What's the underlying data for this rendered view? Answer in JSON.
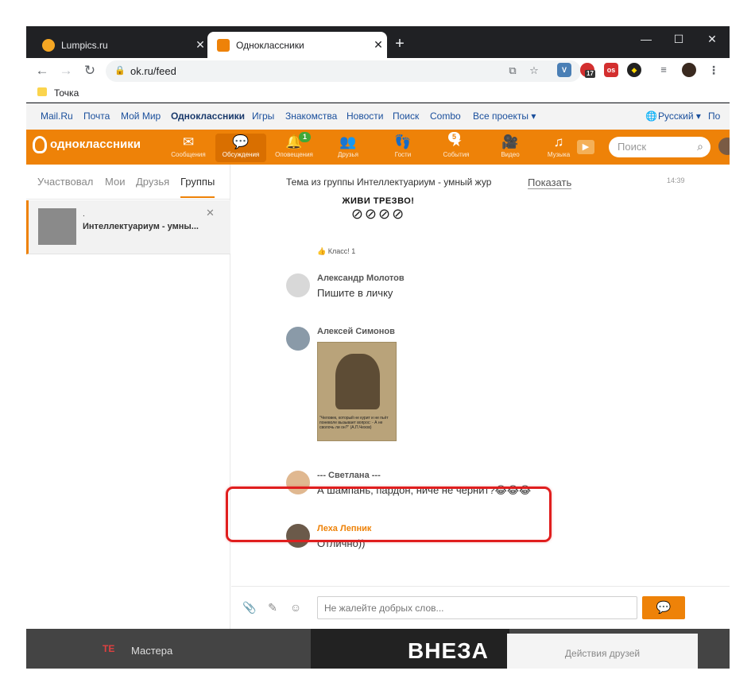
{
  "browser": {
    "tabs": [
      {
        "title": "Lumpics.ru",
        "favicon_color": "#f5a623",
        "active": false
      },
      {
        "title": "Одноклассники",
        "favicon_color": "#ee8208",
        "active": true
      }
    ],
    "url": "ok.ru/feed",
    "bookmark": "Точка",
    "ext_badge": "17"
  },
  "portal": {
    "links": [
      "Mail.Ru",
      "Почта",
      "Мой Мир",
      "Одноклассники",
      "Игры",
      "Знакомства",
      "Новости",
      "Поиск",
      "Combo",
      "Все проекты ▾"
    ],
    "language": "Русский ▾",
    "extra": "По"
  },
  "okbar": {
    "logo": "одноклассники",
    "items": [
      {
        "label": "Сообщения",
        "icon": "envelope-icon"
      },
      {
        "label": "Обсуждения",
        "icon": "chat-bubbles-icon"
      },
      {
        "label": "Оповещения",
        "icon": "bell-icon",
        "badge": "1"
      },
      {
        "label": "Друзья",
        "icon": "friends-icon"
      },
      {
        "label": "Гости",
        "icon": "footprints-icon"
      },
      {
        "label": "События",
        "icon": "events-icon",
        "badge": "5"
      },
      {
        "label": "Видео",
        "icon": "video-camera-icon"
      },
      {
        "label": "Музыка",
        "icon": "music-note-icon"
      }
    ],
    "search_placeholder": "Поиск",
    "accent": "#ee8208"
  },
  "discussions": {
    "tabs": [
      "Участвовал",
      "Мои",
      "Друзья",
      "Группы"
    ],
    "active_tab": "Группы",
    "conversation": {
      "dot": ".",
      "name": "Интеллектуариум - умны..."
    },
    "topic": "Тема из группы Интеллектуариум - умный жур",
    "show_label": "Показать",
    "time": "14:39",
    "poster_title": "ЖИВИ ТРЕЗВО!",
    "likes": "Класс! 1",
    "messages": [
      {
        "author": "Александр Молотов",
        "text": "Пишите в личку"
      },
      {
        "author": "Алексей Симонов",
        "photo_caption": "\"Человек, который не курит и не пьёт поневоле вызывает вопрос: - А не сволочь ли он?\" (А.П.Чехов)"
      },
      {
        "author": "--- Светлана ---",
        "text": "А шампань, пардон, ниче не чернит?😂😂😂"
      },
      {
        "author": "Леха Лепник",
        "text": "Отлично))",
        "author_color": "#ee8208"
      }
    ],
    "compose_placeholder": "Не жалейте добрых слов..."
  },
  "background": {
    "masters": "Мастера",
    "video_text": "ВНЕЗА",
    "friends_actions": "Действия друзей"
  }
}
